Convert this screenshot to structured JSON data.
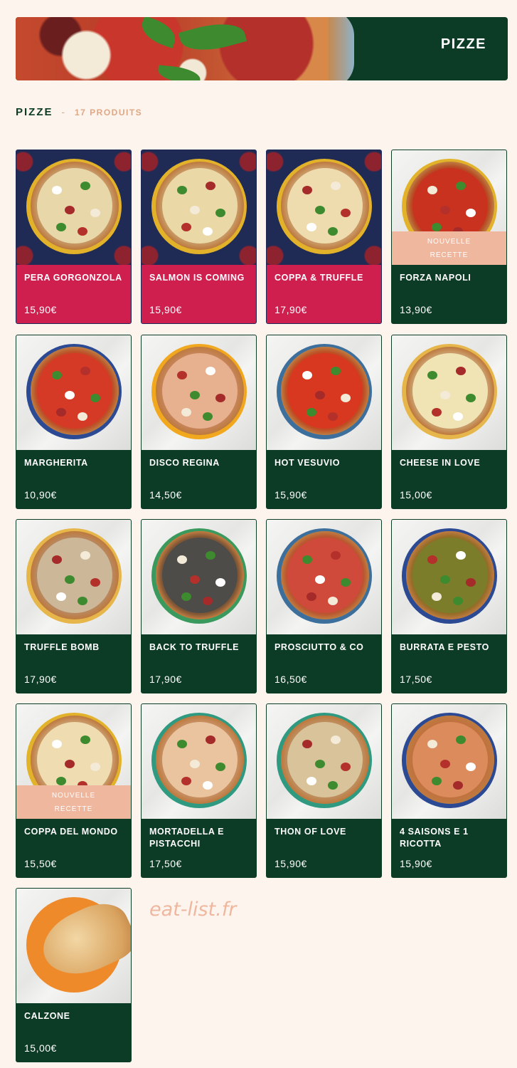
{
  "banner": {
    "title": "PIZZE"
  },
  "section": {
    "name": "PIZZE",
    "separator": "-",
    "count": "17 PRODUITS"
  },
  "badge_text_line1": "NOUVELLE",
  "badge_text_line2": "RECETTE",
  "products": [
    {
      "name": "PERA GORGONZOLA",
      "price": "15,90€",
      "theme": "crimson",
      "badge": false,
      "plate": "#e2b32a",
      "pizza": "#e8d7a9"
    },
    {
      "name": "SALMON IS COMING",
      "price": "15,90€",
      "theme": "crimson",
      "badge": false,
      "plate": "#e2b32a",
      "pizza": "#ead9a6"
    },
    {
      "name": "COPPA & TRUFFLE",
      "price": "17,90€",
      "theme": "crimson",
      "badge": false,
      "plate": "#e2b32a",
      "pizza": "#efdcae"
    },
    {
      "name": "FORZA NAPOLI",
      "price": "13,90€",
      "theme": "green",
      "badge": true,
      "plate": "#e2b32a",
      "pizza": "#c8321f"
    },
    {
      "name": "MARGHERITA",
      "price": "10,90€",
      "theme": "green",
      "badge": false,
      "plate": "#2b4a93",
      "pizza": "#d53a26"
    },
    {
      "name": "DISCO REGINA",
      "price": "14,50€",
      "theme": "green",
      "badge": false,
      "plate": "#f1a81e",
      "pizza": "#e7b08e"
    },
    {
      "name": "HOT VESUVIO",
      "price": "15,90€",
      "theme": "green",
      "badge": false,
      "plate": "#3d6f9d",
      "pizza": "#d7381f"
    },
    {
      "name": "CHEESE IN LOVE",
      "price": "15,00€",
      "theme": "green",
      "badge": false,
      "plate": "#e6b64a",
      "pizza": "#f0e3b4"
    },
    {
      "name": "TRUFFLE BOMB",
      "price": "17,90€",
      "theme": "green",
      "badge": false,
      "plate": "#e6b64a",
      "pizza": "#cdb799"
    },
    {
      "name": "BACK TO TRUFFLE",
      "price": "17,90€",
      "theme": "green",
      "badge": false,
      "plate": "#3a9a5e",
      "pizza": "#4d4c48"
    },
    {
      "name": "PROSCIUTTO & CO",
      "price": "16,50€",
      "theme": "green",
      "badge": false,
      "plate": "#3d6f9d",
      "pizza": "#cf4a3a"
    },
    {
      "name": "BURRATA E PESTO",
      "price": "17,50€",
      "theme": "green",
      "badge": false,
      "plate": "#2b4a93",
      "pizza": "#7c7d2a"
    },
    {
      "name": "COPPA DEL MONDO",
      "price": "15,50€",
      "theme": "green",
      "badge": true,
      "plate": "#e2b32a",
      "pizza": "#efdcb0"
    },
    {
      "name": "MORTADELLA E PISTACCHI",
      "price": "17,50€",
      "theme": "green",
      "badge": false,
      "plate": "#2f9a80",
      "pizza": "#e9c49e"
    },
    {
      "name": "THON OF LOVE",
      "price": "15,90€",
      "theme": "green",
      "badge": false,
      "plate": "#2f9a80",
      "pizza": "#d8c39a"
    },
    {
      "name": "4 SAISONS E 1 RICOTTA",
      "price": "15,90€",
      "theme": "green",
      "badge": false,
      "plate": "#2b4a93",
      "pizza": "#dc8b5c"
    },
    {
      "name": "CALZONE",
      "price": "15,00€",
      "theme": "green",
      "badge": false,
      "plate": "#ee8a2a",
      "pizza": "calzone"
    }
  ],
  "watermark": "eat-list.fr"
}
